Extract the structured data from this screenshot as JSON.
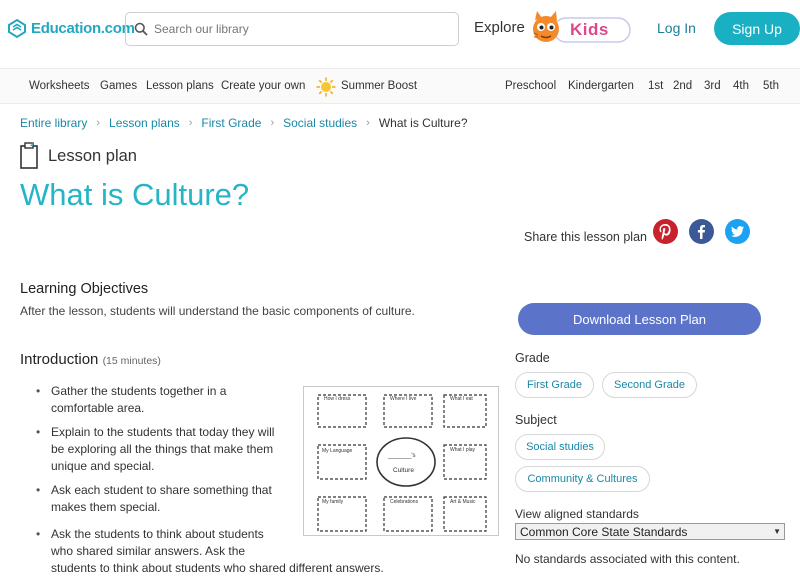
{
  "header": {
    "logo_text": "Education.com",
    "search_placeholder": "Search our library",
    "explore_label": "Explore",
    "kids_label": "Kids",
    "login_label": "Log In",
    "signup_label": "Sign Up",
    "brand_color": "#1ab0c4"
  },
  "subnav": {
    "left_items": [
      "Worksheets",
      "Games",
      "Lesson plans",
      "Create your own",
      "Summer Boost"
    ],
    "grade_items": [
      "Preschool",
      "Kindergarten",
      "1st",
      "2nd",
      "3rd",
      "4th",
      "5th"
    ]
  },
  "breadcrumb": [
    "Entire library",
    "Lesson plans",
    "First Grade",
    "Social studies",
    "What is Culture?"
  ],
  "page": {
    "type_label": "Lesson plan",
    "title": "What is Culture?",
    "share_label": "Share this lesson plan",
    "social_icons": [
      "pinterest-icon",
      "facebook-icon",
      "twitter-icon"
    ]
  },
  "objectives": {
    "heading": "Learning Objectives",
    "text": "After the lesson, students will understand the basic components of culture."
  },
  "introduction": {
    "heading": "Introduction",
    "duration": "(15 minutes)",
    "bullets": [
      "Gather the students together in a comfortable area.",
      "Explain to the students that today they will be exploring all the things that make them unique and special.",
      "Ask each student to share something that makes them special."
    ],
    "bullet4_lines": [
      "Ask the students to think about students",
      "who shared similar answers. Ask the",
      "students to think about students who shared different answers."
    ]
  },
  "worksheet": {
    "boxes": [
      "How I dress",
      "Where I live",
      "What I eat",
      "My Language",
      "What I play",
      "My family",
      "Celebrations",
      "Art & Music"
    ],
    "center_blank": "_______'s",
    "center_word": "Culture"
  },
  "sidebar": {
    "download_label": "Download Lesson Plan",
    "grade_heading": "Grade",
    "grades": [
      "First Grade",
      "Second Grade"
    ],
    "subject_heading": "Subject",
    "subjects": [
      "Social studies",
      "Community & Cultures"
    ],
    "standards_label": "View aligned standards",
    "standards_selected": "Common Core State Standards",
    "no_standards_text": "No standards associated with this content."
  }
}
